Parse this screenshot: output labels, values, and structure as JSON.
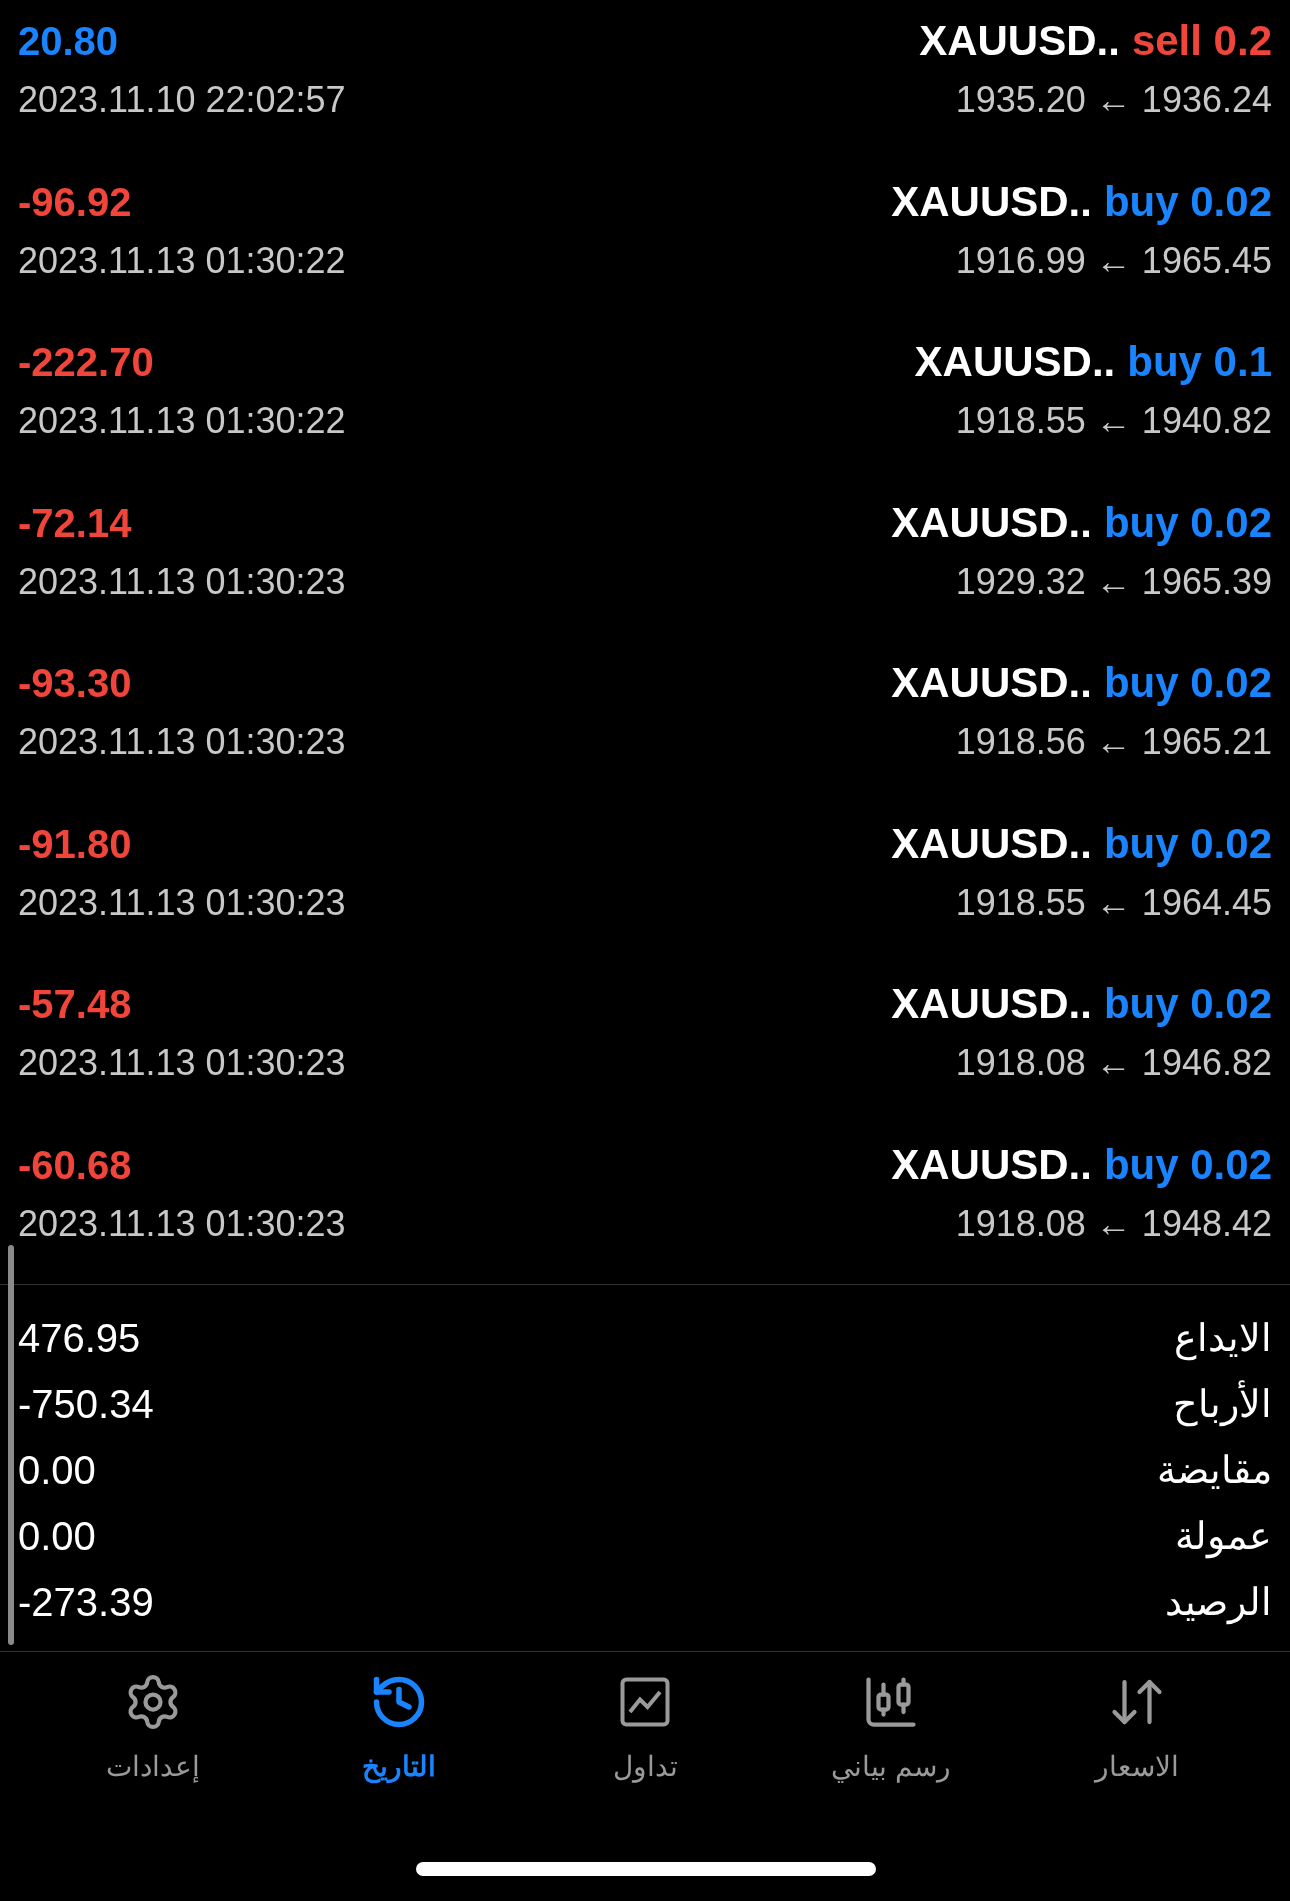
{
  "deals": [
    {
      "symbol": "XAUUSD..",
      "side": "sell",
      "volume": "0.2",
      "prices": "1935.20 ← 1936.24",
      "profit": "20.80",
      "kind": "gain",
      "time": "2023.11.10 22:02:57"
    },
    {
      "symbol": "XAUUSD..",
      "side": "buy",
      "volume": "0.02",
      "prices": "1916.99 ← 1965.45",
      "profit": "-96.92",
      "kind": "loss",
      "time": "2023.11.13 01:30:22"
    },
    {
      "symbol": "XAUUSD..",
      "side": "buy",
      "volume": "0.1",
      "prices": "1918.55 ← 1940.82",
      "profit": "-222.70",
      "kind": "loss",
      "time": "2023.11.13 01:30:22"
    },
    {
      "symbol": "XAUUSD..",
      "side": "buy",
      "volume": "0.02",
      "prices": "1929.32 ← 1965.39",
      "profit": "-72.14",
      "kind": "loss",
      "time": "2023.11.13 01:30:23"
    },
    {
      "symbol": "XAUUSD..",
      "side": "buy",
      "volume": "0.02",
      "prices": "1918.56 ← 1965.21",
      "profit": "-93.30",
      "kind": "loss",
      "time": "2023.11.13 01:30:23"
    },
    {
      "symbol": "XAUUSD..",
      "side": "buy",
      "volume": "0.02",
      "prices": "1918.55 ← 1964.45",
      "profit": "-91.80",
      "kind": "loss",
      "time": "2023.11.13 01:30:23"
    },
    {
      "symbol": "XAUUSD..",
      "side": "buy",
      "volume": "0.02",
      "prices": "1918.08 ← 1946.82",
      "profit": "-57.48",
      "kind": "loss",
      "time": "2023.11.13 01:30:23"
    },
    {
      "symbol": "XAUUSD..",
      "side": "buy",
      "volume": "0.02",
      "prices": "1918.08 ← 1948.42",
      "profit": "-60.68",
      "kind": "loss",
      "time": "2023.11.13 01:30:23"
    }
  ],
  "summary": [
    {
      "label": "الايداع",
      "value": "476.95"
    },
    {
      "label": "الأرباح",
      "value": "-750.34"
    },
    {
      "label": "مقايضة",
      "value": "0.00"
    },
    {
      "label": "عمولة",
      "value": "0.00"
    },
    {
      "label": "الرصيد",
      "value": "-273.39"
    }
  ],
  "tabs": [
    {
      "kind": "quotes",
      "label": "الاسعار",
      "selected": false
    },
    {
      "kind": "chart",
      "label": "رسم بياني",
      "selected": false
    },
    {
      "kind": "trade",
      "label": "تداول",
      "selected": false
    },
    {
      "kind": "history",
      "label": "التاريخ",
      "selected": true
    },
    {
      "kind": "settings",
      "label": "إعدادات",
      "selected": false
    }
  ]
}
